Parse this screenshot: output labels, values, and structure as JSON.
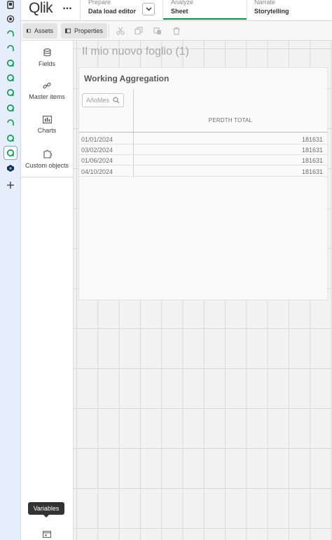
{
  "app": {
    "logo_text": "Qlik",
    "more_label": "..."
  },
  "nav": {
    "prepare": {
      "small": "Prepare",
      "main": "Data load editor"
    },
    "analyze": {
      "small": "Analyze",
      "main": "Sheet"
    },
    "narrate": {
      "small": "Narrate",
      "main": "Storytelling"
    }
  },
  "toolbar": {
    "assets_label": "Assets",
    "properties_label": "Properties"
  },
  "assets_panel": {
    "items": [
      {
        "label": "Fields",
        "icon": "database-icon"
      },
      {
        "label": "Master items",
        "icon": "link-icon"
      },
      {
        "label": "Charts",
        "icon": "bar-chart-icon"
      },
      {
        "label": "Custom objects",
        "icon": "puzzle-icon"
      }
    ],
    "tooltip": "Variables"
  },
  "sheet": {
    "title": "Il mio nuovo foglio (1)"
  },
  "table": {
    "title": "Working Aggregation",
    "search_placeholder": "AñoMes",
    "measure_header": "PERDTH TOTAL",
    "rows": [
      {
        "dim": "01/01/2024",
        "value": "181631"
      },
      {
        "dim": "03/02/2024",
        "value": "181631"
      },
      {
        "dim": "01/06/2024",
        "value": "181631"
      },
      {
        "dim": "04/10/2024",
        "value": "181631"
      }
    ]
  },
  "colors": {
    "accent": "#009845",
    "tabstrip_bg": "#e6eefb",
    "qlik_green": "#009845"
  }
}
